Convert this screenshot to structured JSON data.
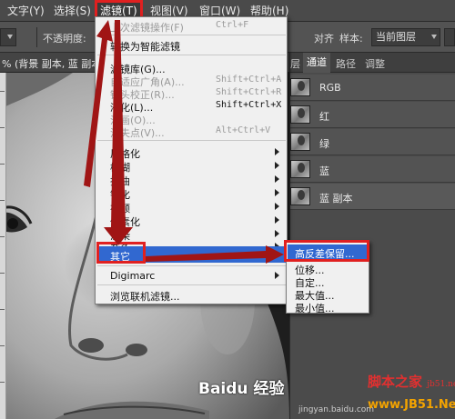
{
  "menubar": {
    "items": [
      "文字(Y)",
      "选择(S)",
      "滤镜(T)",
      "视图(V)",
      "窗口(W)",
      "帮助(H)"
    ]
  },
  "options": {
    "opacity_label": "不透明度:",
    "align_label": "对齐",
    "sample_label": "样本:",
    "sample_value": "当前图层"
  },
  "document": {
    "tab_title": "% (背景 副本, 蓝 副本"
  },
  "layers_panel": {
    "tabs": [
      "层",
      "通道",
      "路径",
      "调整"
    ],
    "channels": [
      "RGB",
      "红",
      "绿",
      "蓝",
      "蓝 副本"
    ]
  },
  "filter_menu": {
    "items": [
      {
        "label": "上次滤镜操作(F)",
        "shortcut": "Ctrl+F"
      },
      {
        "label": "转换为智能滤镜"
      },
      {
        "label": "滤镜库(G)...",
        "shortcut": ""
      },
      {
        "label": "自适应广角(A)...",
        "shortcut": "Shift+Ctrl+A"
      },
      {
        "label": "镜头校正(R)...",
        "shortcut": "Shift+Ctrl+R"
      },
      {
        "label": "液化(L)...",
        "shortcut": "Shift+Ctrl+X"
      },
      {
        "label": "油画(O)...",
        "shortcut": ""
      },
      {
        "label": "消失点(V)...",
        "shortcut": "Alt+Ctrl+V"
      },
      {
        "label": "风格化"
      },
      {
        "label": "模糊"
      },
      {
        "label": "扭曲"
      },
      {
        "label": "锐化"
      },
      {
        "label": "视频"
      },
      {
        "label": "像素化"
      },
      {
        "label": "渲染"
      },
      {
        "label": "杂色"
      },
      {
        "label": "其它"
      },
      {
        "label": "Digimarc"
      },
      {
        "label": "浏览联机滤镜..."
      }
    ]
  },
  "other_submenu": {
    "items": [
      "高反差保留...",
      "位移...",
      "自定...",
      "最大值...",
      "最小值..."
    ]
  },
  "watermarks": {
    "logo": "脚本之家",
    "logo_sub": "jb51.net",
    "url": "www.JB51.Net",
    "baidu": "Baidu 经验",
    "baidu_url": "jingyan.baidu.com"
  },
  "colors": {
    "highlight": "#3168d0",
    "callout": "#e02020",
    "arrow": "#a01515"
  }
}
